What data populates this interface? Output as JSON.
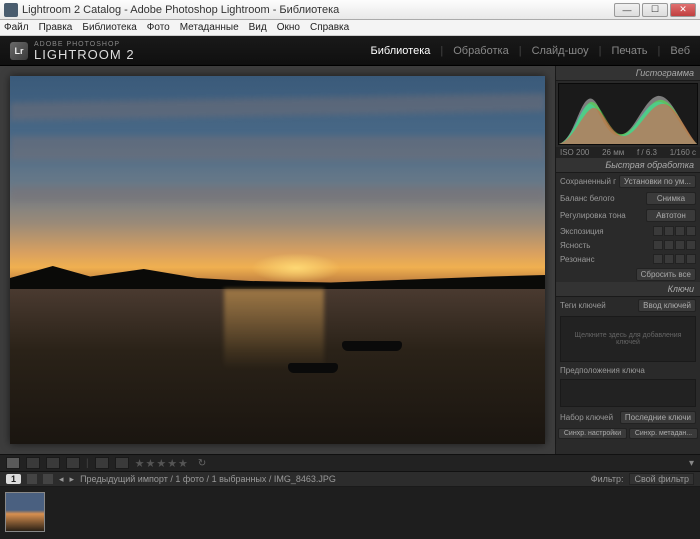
{
  "window": {
    "title": "Lightroom 2 Catalog - Adobe Photoshop Lightroom - Библиотека",
    "menu": [
      "Файл",
      "Правка",
      "Библиотека",
      "Фото",
      "Метаданные",
      "Вид",
      "Окно",
      "Справка"
    ]
  },
  "brand": {
    "logo": "Lr",
    "small": "ADOBE PHOTOSHOP",
    "large": "LIGHTROOM 2"
  },
  "modules": {
    "items": [
      "Библиотека",
      "Обработка",
      "Слайд-шоу",
      "Печать",
      "Веб"
    ],
    "active": 0
  },
  "panels": {
    "histogram": {
      "title": "Гистограмма",
      "iso": "ISO 200",
      "focal": "26 мм",
      "aperture": "f / 6.3",
      "shutter": "1/160 с"
    },
    "quickdev": {
      "title": "Быстрая обработка",
      "preset_lbl": "Сохраненный пресет",
      "preset_val": "Установки по ум...",
      "wb_lbl": "Баланс белого",
      "wb_val": "Снимка",
      "tone_lbl": "Регулировка тона",
      "tone_btn": "Автотон",
      "exposure_lbl": "Экспозиция",
      "clarity_lbl": "Ясность",
      "vibrance_lbl": "Резонанс",
      "reset": "Сбросить все"
    },
    "keywords": {
      "title": "Ключи",
      "tags_lbl": "Теги ключей",
      "tags_val": "Ввод ключей",
      "placeholder": "Щелкните здесь для добавления ключей",
      "suggest_lbl": "Предположения ключа",
      "set_lbl": "Набор ключей",
      "set_val": "Последние ключи"
    },
    "sync": {
      "settings": "Синхр. настройки",
      "meta": "Синхр. метадан..."
    }
  },
  "filmheader": {
    "badge": "1",
    "crumb": "Предыдущий импорт / 1 фото / 1 выбранных / IMG_8463.JPG",
    "filter_lbl": "Фильтр:",
    "filter_val": "Свой фильтр"
  }
}
